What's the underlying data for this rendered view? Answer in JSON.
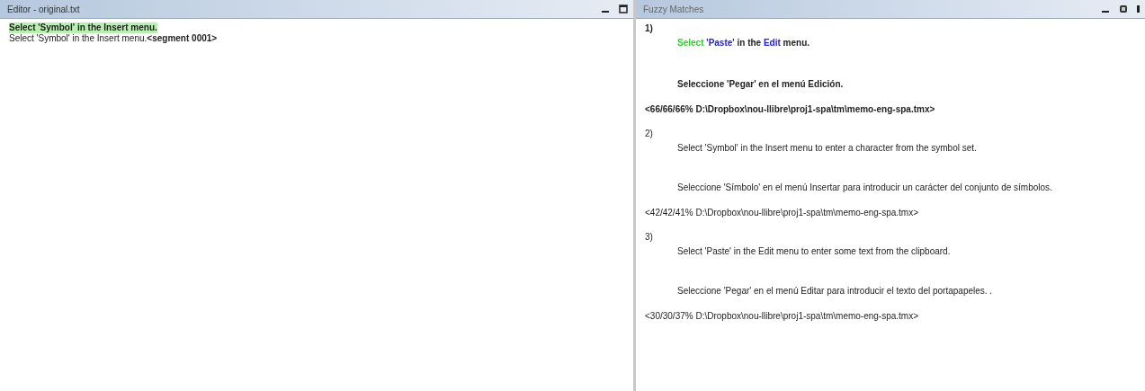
{
  "editor": {
    "title": "Editor - original.txt",
    "lines": [
      {
        "text": "Select 'Symbol' in the Insert menu.",
        "selected": true
      },
      {
        "text": "Select 'Symbol' in the Insert menu.**<segment 0001>**",
        "selected": false
      }
    ]
  },
  "fuzzy_matches": {
    "title": "Fuzzy Matches",
    "matches": [
      {
        "number": "1)",
        "selected": true,
        "source": [
          {
            "text": "Select",
            "kind": "insert"
          },
          {
            "text": "'Paste'",
            "kind": "change"
          },
          {
            "text": "in the",
            "kind": "plain"
          },
          {
            "text": "Edit",
            "kind": "change"
          },
          {
            "text": "menu.",
            "kind": "plain"
          }
        ],
        "target": "Seleccione 'Pegar' en el menú Edición.",
        "origin": "<66/66/66% D:\\Dropbox\\nou-llibre\\proj1-spa\\tm\\memo-eng-spa.tmx>"
      },
      {
        "number": "2)",
        "selected": false,
        "source": [
          {
            "text": "Select 'Symbol' in the Insert menu to enter a character from the symbol set.",
            "kind": "plain"
          }
        ],
        "target": "Seleccione 'Símbolo' en el menú Insertar para introducir un carácter del conjunto de símbolos.",
        "origin": "<42/42/41% D:\\Dropbox\\nou-llibre\\proj1-spa\\tm\\memo-eng-spa.tmx>"
      },
      {
        "number": "3)",
        "selected": false,
        "source": [
          {
            "text": "Select 'Paste' in the Edit menu to enter some text from the clipboard.",
            "kind": "plain"
          }
        ],
        "target": "Seleccione 'Pegar' en el menú Editar para introducir el texto del portapapeles. .",
        "origin": "<30/30/37% D:\\Dropbox\\nou-llibre\\proj1-spa\\tm\\memo-eng-spa.tmx>"
      }
    ]
  }
}
